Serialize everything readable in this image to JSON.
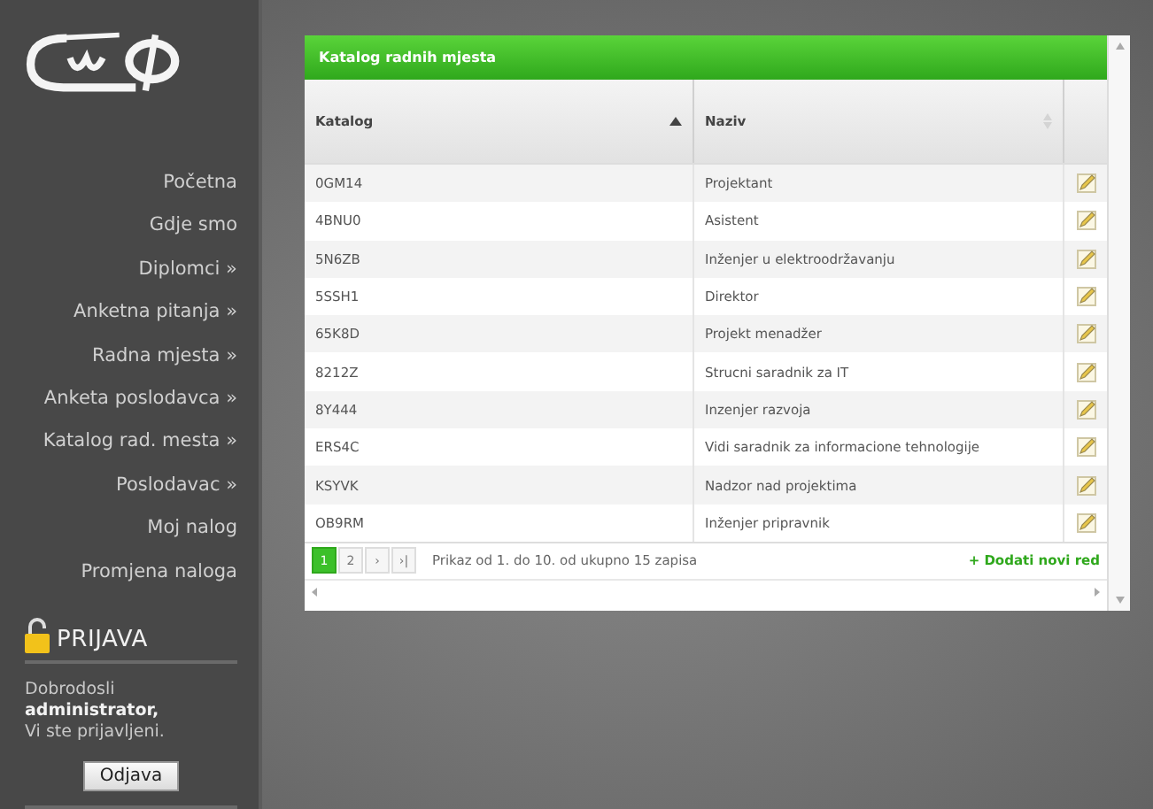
{
  "sidebar": {
    "nav_items": [
      {
        "label": "Početna"
      },
      {
        "label": "Gdje smo"
      },
      {
        "label": "Diplomci »"
      },
      {
        "label": "Anketna pitanja »"
      },
      {
        "label": "Radna mjesta »"
      },
      {
        "label": "Anketa poslodavca »"
      },
      {
        "label": "Katalog rad. mesta »"
      },
      {
        "label": "Poslodavac »"
      },
      {
        "label": "Moj nalog"
      },
      {
        "label": "Promjena naloga"
      }
    ],
    "login": {
      "title": "PRIJAVA",
      "lines": [
        {
          "text": "Dobrodosli",
          "bold": false
        },
        {
          "text": "administrator,",
          "bold": true
        },
        {
          "text": "Vi ste prijavljeni.",
          "bold": false
        }
      ],
      "logout_button": "Odjava"
    }
  },
  "grid": {
    "title": "Katalog radnih mjesta",
    "columns": [
      {
        "label": "Katalog",
        "sorted": true
      },
      {
        "label": "Naziv",
        "sorted": false
      }
    ],
    "rows": [
      {
        "katalog": "0GM14",
        "naziv": "Projektant"
      },
      {
        "katalog": "4BNU0",
        "naziv": "Asistent"
      },
      {
        "katalog": "5N6ZB",
        "naziv": "Inženjer u elektroodržavanju"
      },
      {
        "katalog": "5SSH1",
        "naziv": "Direktor"
      },
      {
        "katalog": "65K8D",
        "naziv": "Projekt menadžer"
      },
      {
        "katalog": "8212Z",
        "naziv": "Strucni saradnik za IT"
      },
      {
        "katalog": "8Y444",
        "naziv": "Inzenjer razvoja"
      },
      {
        "katalog": "ERS4C",
        "naziv": "Vidi saradnik za informacione tehnologije"
      },
      {
        "katalog": "KSYVK",
        "naziv": "Nadzor nad projektima"
      },
      {
        "katalog": "OB9RM",
        "naziv": "Inženjer pripravnik"
      }
    ],
    "pager": {
      "pages": [
        {
          "label": "1",
          "selected": true
        },
        {
          "label": "2",
          "selected": false
        }
      ],
      "next": "›",
      "last": "›|",
      "info": "Prikaz od 1. do 10. od ukupno 15 zapisa"
    },
    "add_link": "+ Dodati novi red"
  }
}
